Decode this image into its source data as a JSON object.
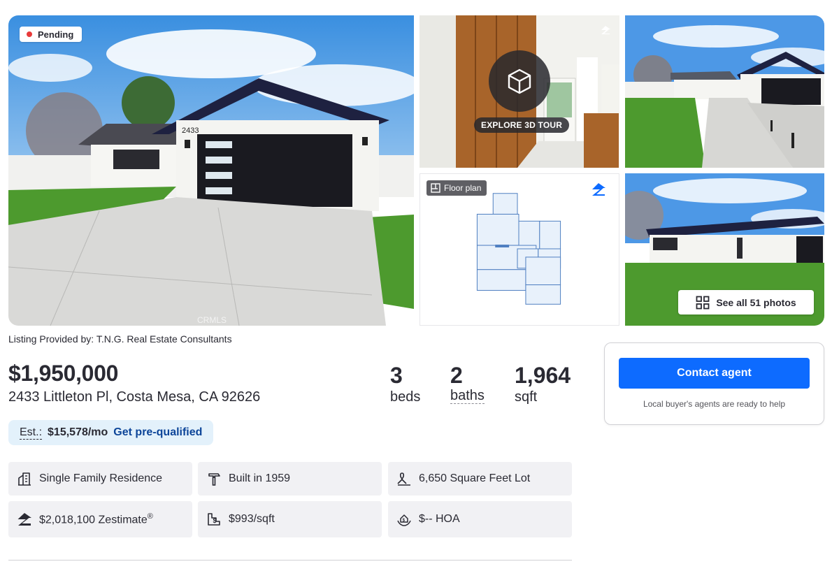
{
  "gallery": {
    "status_badge": "Pending",
    "status_color": "#e83a3a",
    "tour_label": "EXPLORE 3D TOUR",
    "floorplan_label": "Floor plan",
    "see_all_label": "See all 51 photos",
    "house_number": "2433",
    "watermark": "CRMLS"
  },
  "listing": {
    "provided_by": "Listing Provided by: T.N.G. Real Estate Consultants",
    "price": "$1,950,000",
    "address": "2433 Littleton Pl, Costa Mesa, CA 92626",
    "beds_value": "3",
    "beds_label": "beds",
    "baths_value": "2",
    "baths_label": "baths",
    "sqft_value": "1,964",
    "sqft_label": "sqft",
    "est_label": "Est.:",
    "est_value": "$15,578/mo",
    "prequal_link": "Get pre-qualified"
  },
  "facts": [
    {
      "icon": "building-icon",
      "text": "Single Family Residence"
    },
    {
      "icon": "hammer-icon",
      "text": "Built in 1959"
    },
    {
      "icon": "lot-icon",
      "text": "6,650 Square Feet Lot"
    },
    {
      "icon": "zestimate-icon",
      "text": "$2,018,100 Zestimate",
      "suffix": "®"
    },
    {
      "icon": "price-per-sqft-icon",
      "text": "$993/sqft"
    },
    {
      "icon": "hoa-icon",
      "text": "$-- HOA"
    }
  ],
  "contact": {
    "button_label": "Contact agent",
    "note": "Local buyer's agents are ready to help"
  },
  "colors": {
    "accent": "#0d6bff",
    "link": "#0d4599",
    "est_bg": "#e3f1fb",
    "fact_bg": "#f1f1f4"
  }
}
